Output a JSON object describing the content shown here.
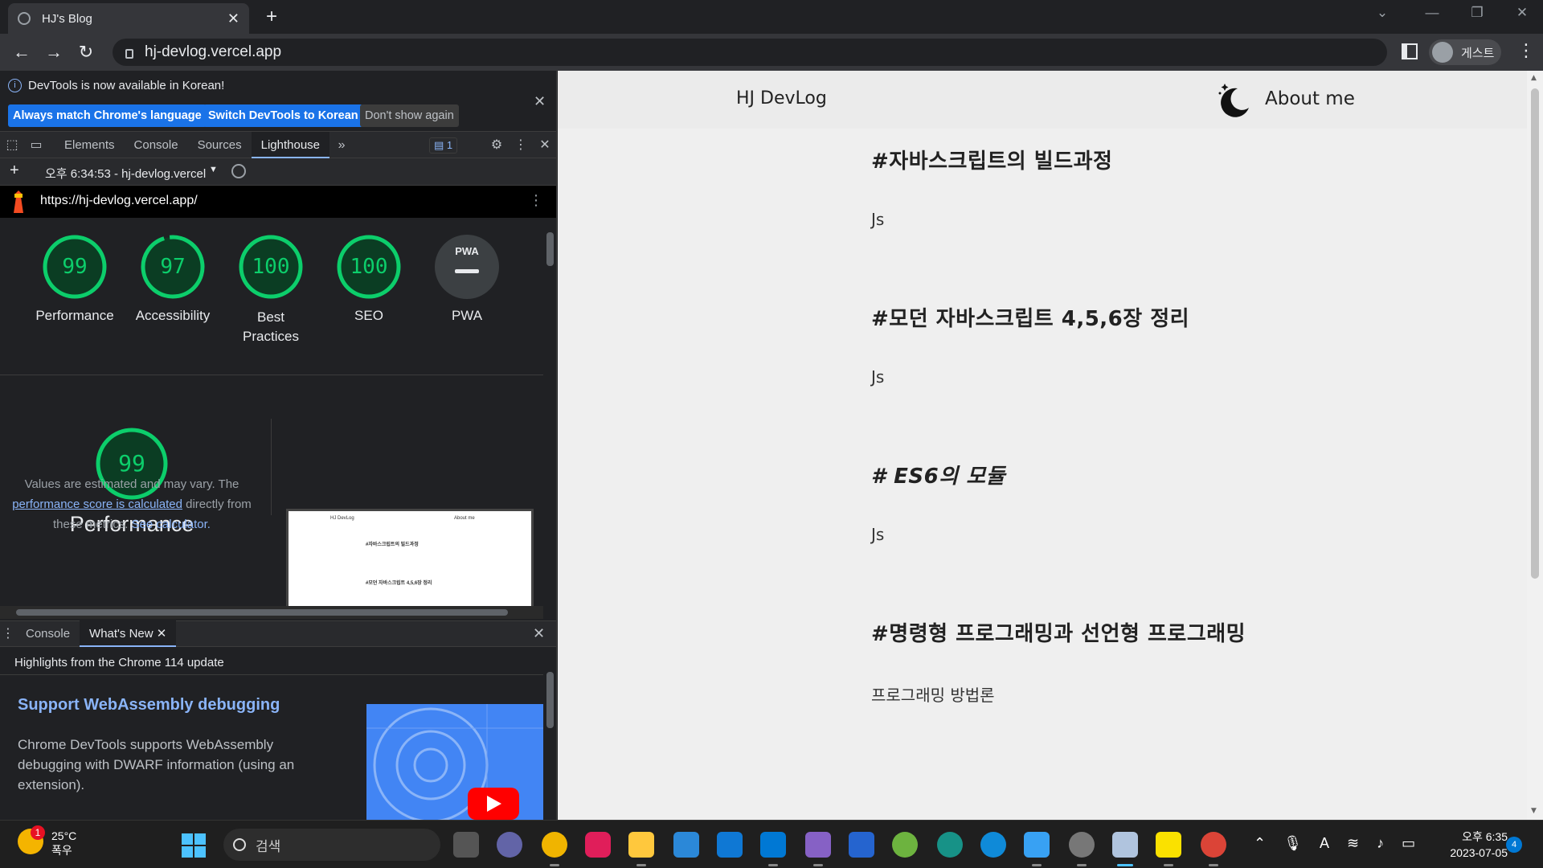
{
  "browser": {
    "tab_title": "HJ's Blog",
    "url": "hj-devlog.vercel.app",
    "profile_label": "게스트"
  },
  "devtools": {
    "infobar_message": "DevTools is now available in Korean!",
    "btn_match": "Always match Chrome's language",
    "btn_switch": "Switch DevTools to Korean",
    "btn_dont_show": "Don't show again",
    "tabs": [
      "Elements",
      "Console",
      "Sources",
      "Lighthouse"
    ],
    "active_tab": "Lighthouse",
    "issues_count": "1",
    "report_label": "오후 6:34:53 - hj-devlog.vercel",
    "report_url": "https://hj-devlog.vercel.app/",
    "scores": [
      {
        "label": "Performance",
        "value": 99
      },
      {
        "label": "Accessibility",
        "value": 97
      },
      {
        "label": "Best Practices",
        "value": 100
      },
      {
        "label": "SEO",
        "value": 100
      },
      {
        "label": "PWA",
        "value": null
      }
    ],
    "pwa_badge": "PWA",
    "perf_title": "Performance",
    "perf_score": 99,
    "perf_desc_1": "Values are estimated and may vary. The",
    "perf_desc_link": "performance score is calculated",
    "perf_desc_2": "directly from",
    "perf_desc_3": "these metrics.",
    "perf_desc_link2": "See calculator.",
    "drawer_tabs": [
      "Console",
      "What's New"
    ],
    "drawer_active": "What's New",
    "highlights": "Highlights from the Chrome 114 update",
    "wn_title": "Support WebAssembly debugging",
    "wn_body": "Chrome DevTools supports WebAssembly debugging with DWARF information (using an extension).",
    "colors": {
      "score_good": "#0cce6b",
      "link": "#8ab4f8",
      "accent": "#1a73e8"
    }
  },
  "page": {
    "brand": "HJ DevLog",
    "about": "About me",
    "posts": [
      {
        "title": "#자바스크립트의 빌드과정",
        "tag": "Js"
      },
      {
        "title": "#모던 자바스크립트 4,5,6장 정리",
        "tag": "Js"
      },
      {
        "title": "# ES6의 모듈",
        "tag": "Js"
      },
      {
        "title": "#명령형 프로그래밍과 선언형 프로그래밍",
        "tag": "프로그래밍 방법론"
      }
    ]
  },
  "taskbar": {
    "weather_temp": "25°C",
    "weather_desc": "폭우",
    "weather_badge": "1",
    "search_placeholder": "검색",
    "time": "오후 6:35",
    "date": "2023-07-05",
    "notification_count": "4",
    "apps": [
      "task-view",
      "teams",
      "chrome-canary",
      "slack",
      "file-explorer",
      "microsoft-store",
      "mail",
      "vscode",
      "visual-studio",
      "todo",
      "spring",
      "gitkraken",
      "edge",
      "notepad",
      "settings",
      "snipping-tool",
      "kakaotalk",
      "chrome"
    ]
  }
}
